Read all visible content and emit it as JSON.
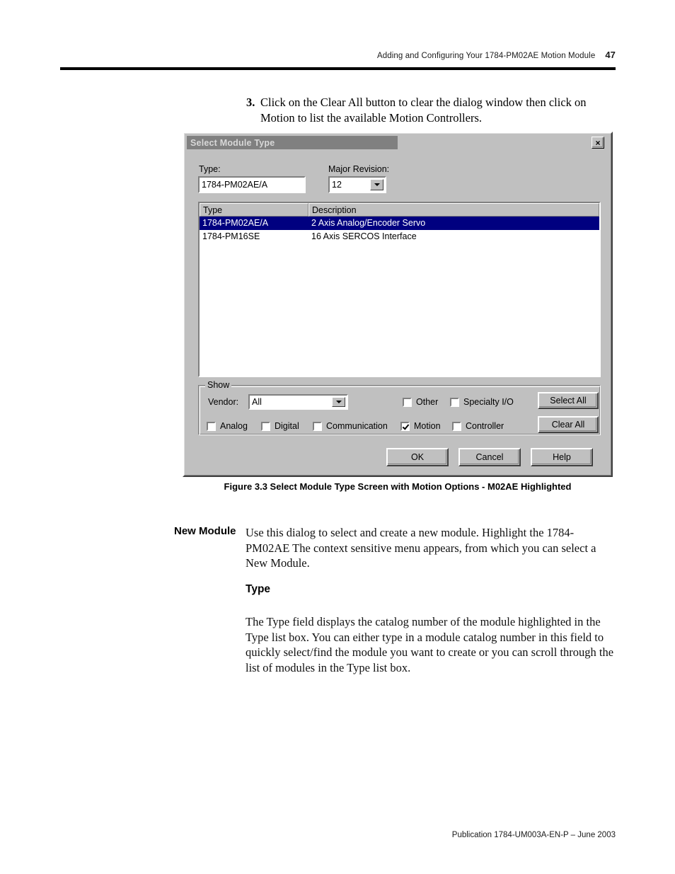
{
  "page": {
    "running_head": "Adding and Configuring Your 1784-PM02AE Motion Module",
    "page_number": "47",
    "footer": "Publication 1784-UM003A-EN-P – June 2003"
  },
  "step": {
    "number": "3.",
    "text": "Click on the Clear All button to clear the dialog window then click on Motion to list the available Motion Controllers."
  },
  "dialog": {
    "title": "Select Module Type",
    "close_label": "×",
    "type_label": "Type:",
    "type_value": "1784-PM02AE/A",
    "revision_label": "Major Revision:",
    "revision_value": "12",
    "columns": {
      "type": "Type",
      "description": "Description"
    },
    "rows": [
      {
        "type": "1784-PM02AE/A",
        "description": "2 Axis Analog/Encoder Servo",
        "selected": true
      },
      {
        "type": "1784-PM16SE",
        "description": "16 Axis SERCOS Interface",
        "selected": false
      }
    ],
    "show_group": {
      "title": "Show",
      "vendor_label": "Vendor:",
      "vendor_value": "All",
      "checkboxes": [
        {
          "label": "Other",
          "checked": false
        },
        {
          "label": "Specialty I/O",
          "checked": false
        },
        {
          "label": "Analog",
          "checked": false
        },
        {
          "label": "Digital",
          "checked": false
        },
        {
          "label": "Communication",
          "checked": false
        },
        {
          "label": "Motion",
          "checked": true
        },
        {
          "label": "Controller",
          "checked": false
        }
      ],
      "select_all_label": "Select All",
      "clear_all_label": "Clear All"
    },
    "ok_label": "OK",
    "cancel_label": "Cancel",
    "help_label": "Help"
  },
  "figure": {
    "caption": "Figure 3.3 Select Module Type Screen with Motion Options - M02AE Highlighted"
  },
  "sections": {
    "new_module": {
      "label": "New Module",
      "text": "Use this dialog to select and create a new module. Highlight the 1784-PM02AE The context sensitive menu appears, from which you can select a New Module."
    },
    "type": {
      "heading": "Type",
      "text": "The Type field displays the catalog number of the module highlighted in the Type list box. You can either type in a module catalog number in this field to quickly select/find the module you want to create or you can scroll through the list of modules in the Type list box."
    }
  },
  "colors": {
    "dialog_face": "#c0c0c0",
    "titlebar": "#808080",
    "selection": "#000080",
    "field_bg": "#ffffff"
  }
}
